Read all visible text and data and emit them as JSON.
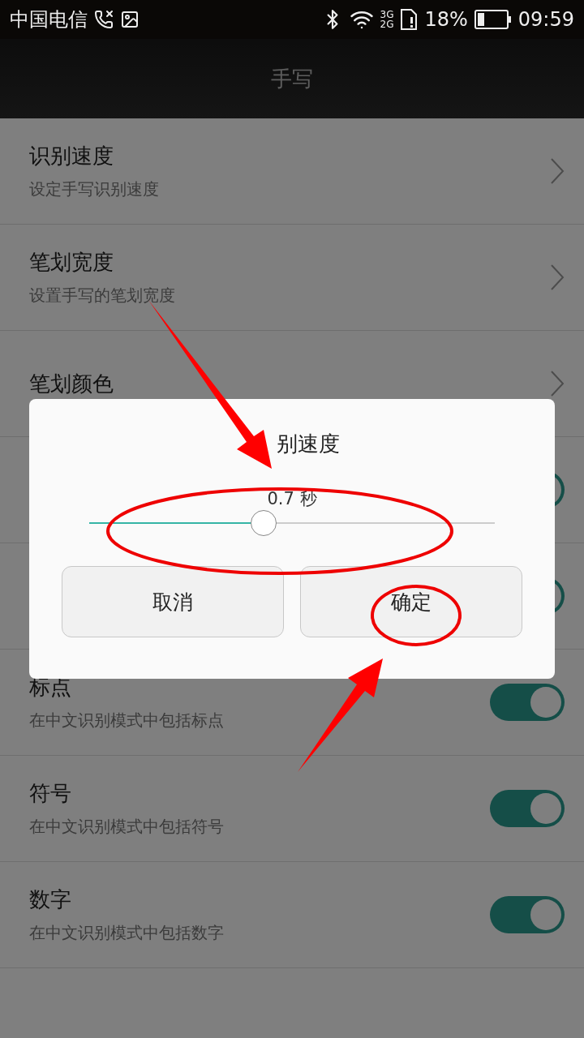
{
  "status_bar": {
    "carrier": "中国电信",
    "network_top": "3G",
    "network_bottom": "2G",
    "battery": "18%",
    "time": "09:59"
  },
  "title": "手写",
  "settings": [
    {
      "kind": "link",
      "title": "识别速度",
      "subtitle": "设定手写识别速度"
    },
    {
      "kind": "link",
      "title": "笔划宽度",
      "subtitle": "设置手写的笔划宽度"
    },
    {
      "kind": "link",
      "title": "笔划颜色"
    },
    {
      "kind": "toggle",
      "on": true
    },
    {
      "kind": "toggle",
      "on": true
    },
    {
      "kind": "toggle",
      "title": "标点",
      "subtitle": "在中文识别模式中包括标点",
      "on": true
    },
    {
      "kind": "toggle",
      "title": "符号",
      "subtitle": "在中文识别模式中包括符号",
      "on": true
    },
    {
      "kind": "toggle",
      "title": "数字",
      "subtitle": "在中文识别模式中包括数字",
      "on": true
    }
  ],
  "dialog": {
    "title": "别速度",
    "value": "0.7 秒",
    "slider": {
      "level": 0.43
    },
    "buttons": [
      "取消",
      "确定"
    ]
  }
}
